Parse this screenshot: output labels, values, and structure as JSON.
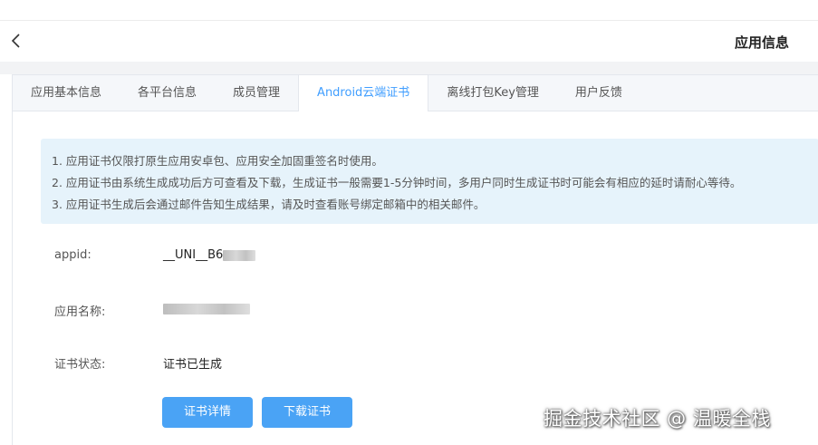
{
  "header": {
    "title": "应用信息"
  },
  "tabs": [
    {
      "label": "应用基本信息"
    },
    {
      "label": "各平台信息"
    },
    {
      "label": "成员管理"
    },
    {
      "label": "Android云端证书",
      "active": true
    },
    {
      "label": "离线打包Key管理"
    },
    {
      "label": "用户反馈"
    }
  ],
  "notice": {
    "lines": [
      "1. 应用证书仅限打原生应用安卓包、应用安全加固重签名时使用。",
      "2. 应用证书由系统生成成功后方可查看及下载，生成证书一般需要1-5分钟时间，多用户同时生成证书时可能会有相应的延时请耐心等待。",
      "3. 应用证书生成后会通过邮件告知生成结果，请及时查看账号绑定邮箱中的相关邮件。"
    ]
  },
  "fields": {
    "appid_label": "appid:",
    "appid_value": "__UNI__B6",
    "app_name_label": "应用名称:",
    "status_label": "证书状态:",
    "status_value": "证书已生成"
  },
  "buttons": {
    "details": "证书详情",
    "download": "下载证书"
  },
  "watermark": "掘金技术社区 @ 温暖全栈",
  "colors": {
    "accent": "#409eff",
    "button": "#4aa3f5",
    "notice_bg": "#e6f3fb"
  }
}
